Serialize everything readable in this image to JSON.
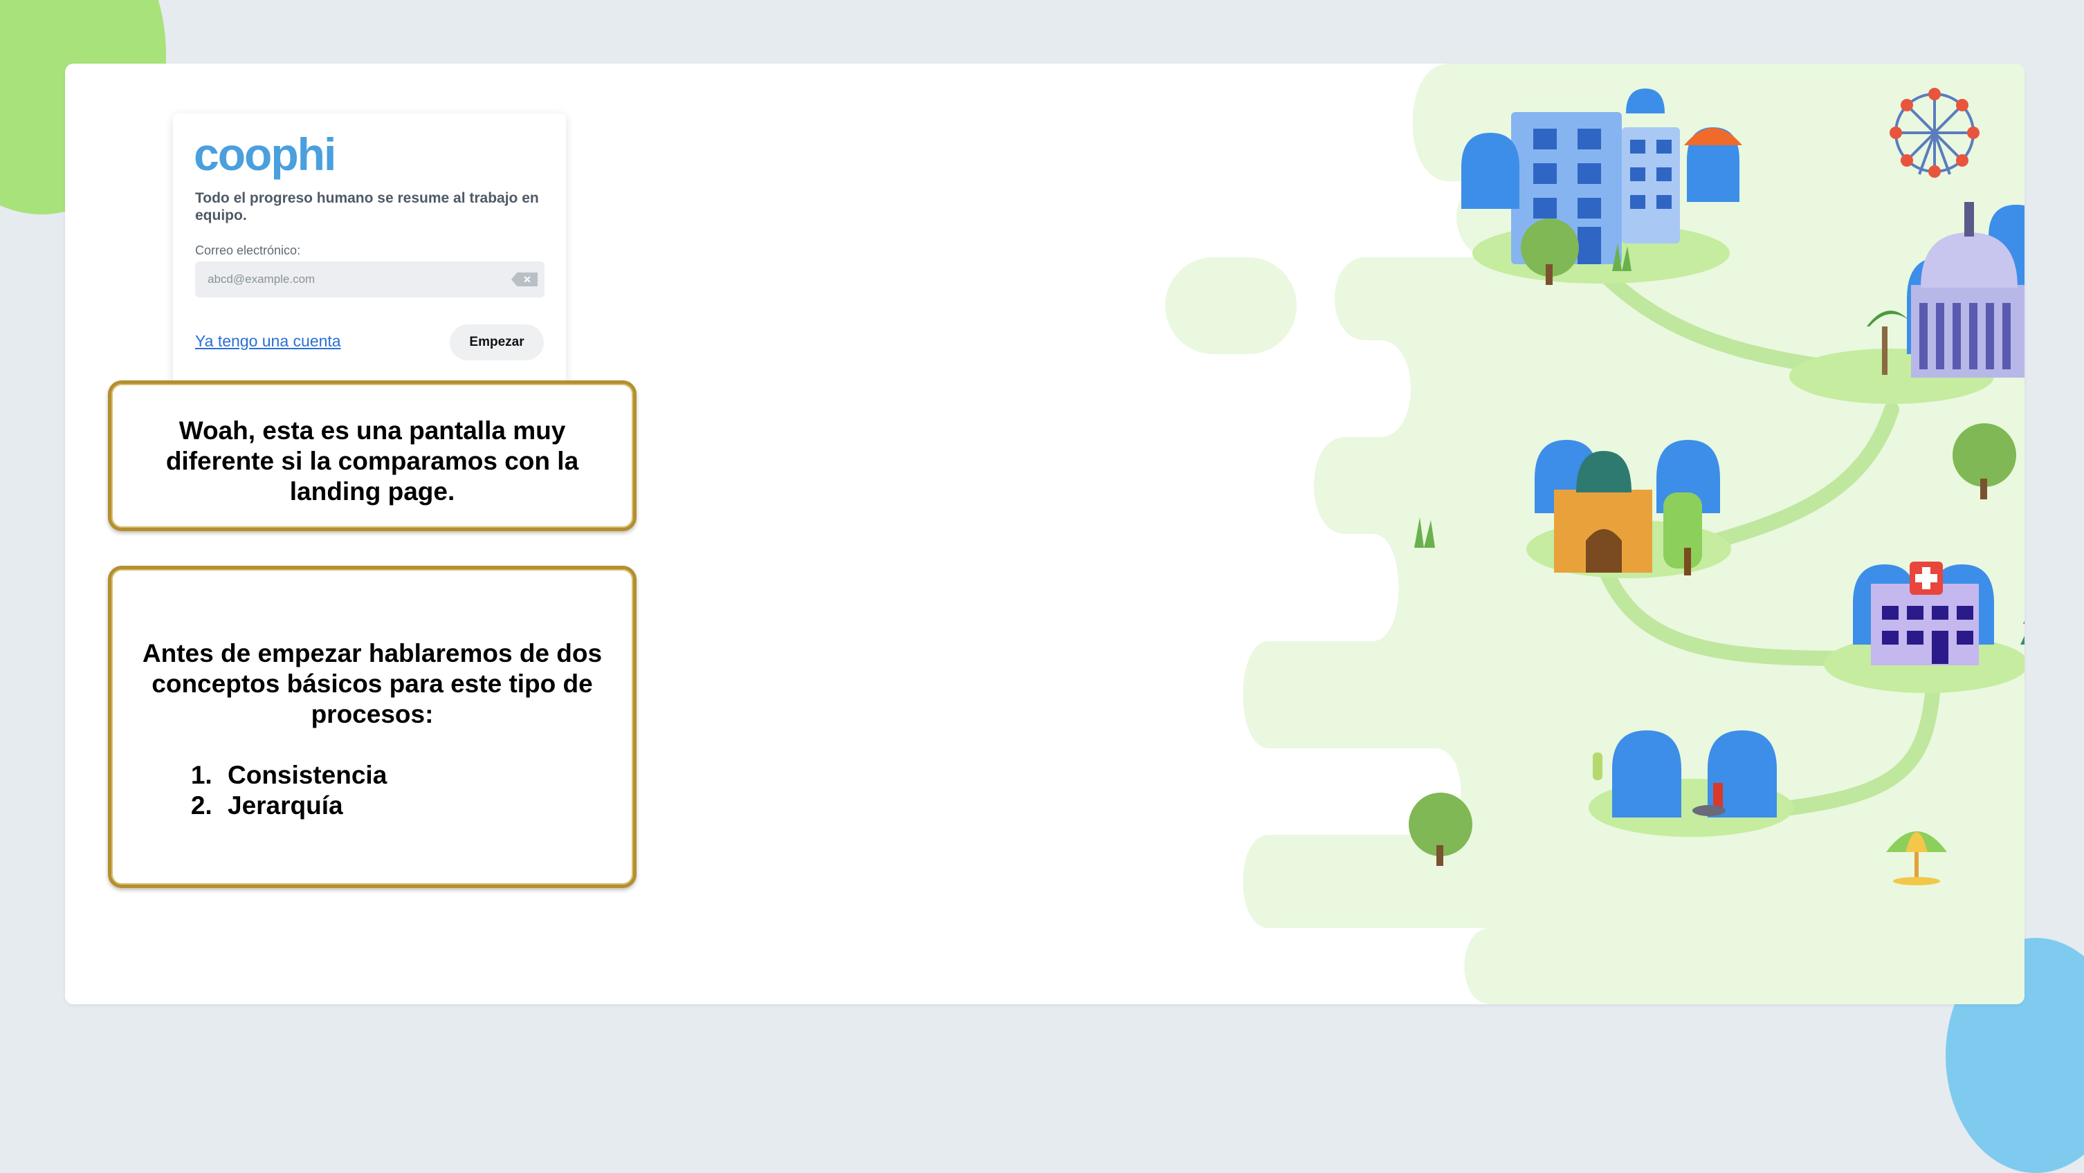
{
  "login": {
    "logo": "coophi",
    "tagline": "Todo el progreso humano se resume al trabajo en equipo.",
    "email_label": "Correo electrónico:",
    "email_placeholder": "abcd@example.com",
    "clear_icon": "backspace-icon",
    "have_account_link": "Ya tengo una cuenta",
    "start_button": "Empezar"
  },
  "notes": {
    "note1": "Woah, esta es una pantalla muy diferente si la comparamos con la landing page.",
    "note2_intro": "Antes de empezar hablaremos de dos conceptos básicos para este tipo de procesos:",
    "note2_items": [
      "Consistencia",
      "Jerarquía"
    ]
  },
  "colors": {
    "brand_blue": "#4a9fde",
    "link_blue": "#2a6fd6",
    "note_border_gold": "#b48f2e",
    "illustration_bg": "#e9f8df",
    "path_green": "#bfe79e",
    "creature_blue": "#3d8ee8"
  },
  "illustration": {
    "icons": [
      "office-building-icon",
      "capitol-building-icon",
      "church-icon",
      "hospital-icon",
      "laboratory-icon",
      "ferris-wheel-icon",
      "tree-icon",
      "grass-icon",
      "umbrella-icon",
      "blue-creature-icon"
    ]
  }
}
